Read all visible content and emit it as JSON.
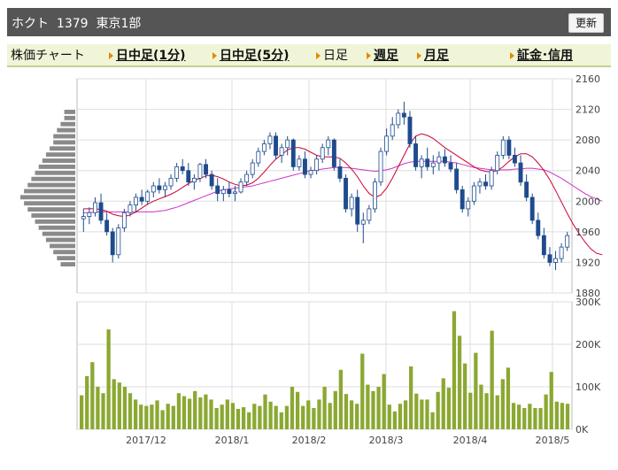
{
  "header": {
    "stock_name": "ホクト",
    "code": "1379",
    "market": "東京1部",
    "refresh_label": "更新"
  },
  "tabs": {
    "label": "株価チャート",
    "intraday_1": "日中足(1分)",
    "intraday_5": "日中足(5分)",
    "daily": "日足",
    "weekly": "週足",
    "monthly": "月足",
    "margin": "証金･信用"
  },
  "colors": {
    "up": "#ffffff",
    "down": "#1e4b8c",
    "candle_edge": "#1e4b8c",
    "ma_short": "#cc0033",
    "ma_long": "#cc33cc",
    "volume": "#8ba832",
    "profile": "#8a8a8a"
  },
  "chart_data": [
    {
      "type": "candlestick",
      "price_ylim": [
        1880,
        2160
      ],
      "price_ticks": [
        "2160",
        "2120",
        "2080",
        "2040",
        "2000",
        "1960",
        "1920",
        "1880"
      ],
      "x_labels": [
        "2017/12",
        "2018/1",
        "2018/2",
        "2018/3",
        "2018/4",
        "2018/5"
      ],
      "candles": [
        [
          1977,
          1990,
          1960,
          1980
        ],
        [
          1980,
          1992,
          1970,
          1985
        ],
        [
          1985,
          2005,
          1980,
          1998
        ],
        [
          1998,
          2010,
          1970,
          1975
        ],
        [
          1975,
          1985,
          1955,
          1960
        ],
        [
          1960,
          1965,
          1920,
          1930
        ],
        [
          1930,
          1970,
          1925,
          1965
        ],
        [
          1965,
          1990,
          1960,
          1985
        ],
        [
          1985,
          2000,
          1980,
          1995
        ],
        [
          1995,
          2010,
          1985,
          2005
        ],
        [
          2005,
          2015,
          1995,
          2000
        ],
        [
          2000,
          2015,
          1995,
          2012
        ],
        [
          2012,
          2025,
          2005,
          2020
        ],
        [
          2020,
          2030,
          2010,
          2015
        ],
        [
          2015,
          2025,
          2005,
          2020
        ],
        [
          2020,
          2035,
          2015,
          2030
        ],
        [
          2030,
          2050,
          2025,
          2045
        ],
        [
          2045,
          2055,
          2035,
          2040
        ],
        [
          2040,
          2050,
          2020,
          2025
        ],
        [
          2025,
          2035,
          2015,
          2030
        ],
        [
          2030,
          2050,
          2025,
          2048
        ],
        [
          2048,
          2055,
          2030,
          2035
        ],
        [
          2035,
          2040,
          2015,
          2020
        ],
        [
          2020,
          2030,
          2000,
          2010
        ],
        [
          2010,
          2020,
          2000,
          2015
        ],
        [
          2015,
          2025,
          2005,
          2010
        ],
        [
          2010,
          2020,
          2000,
          2012
        ],
        [
          2012,
          2030,
          2010,
          2025
        ],
        [
          2025,
          2040,
          2020,
          2035
        ],
        [
          2035,
          2055,
          2030,
          2050
        ],
        [
          2050,
          2070,
          2045,
          2065
        ],
        [
          2065,
          2080,
          2060,
          2075
        ],
        [
          2075,
          2090,
          2068,
          2085
        ],
        [
          2085,
          2090,
          2055,
          2060
        ],
        [
          2060,
          2075,
          2050,
          2070
        ],
        [
          2070,
          2085,
          2060,
          2080
        ],
        [
          2080,
          2082,
          2040,
          2045
        ],
        [
          2045,
          2060,
          2040,
          2055
        ],
        [
          2055,
          2065,
          2030,
          2035
        ],
        [
          2035,
          2045,
          2030,
          2040
        ],
        [
          2040,
          2060,
          2035,
          2055
        ],
        [
          2055,
          2075,
          2050,
          2070
        ],
        [
          2070,
          2085,
          2060,
          2080
        ],
        [
          2080,
          2082,
          2040,
          2045
        ],
        [
          2045,
          2055,
          2025,
          2030
        ],
        [
          2030,
          2035,
          1985,
          1990
        ],
        [
          1990,
          2010,
          1980,
          2005
        ],
        [
          2005,
          2015,
          1960,
          1970
        ],
        [
          1970,
          1985,
          1945,
          1975
        ],
        [
          1975,
          1995,
          1970,
          1990
        ],
        [
          1990,
          2030,
          1985,
          2025
        ],
        [
          2025,
          2070,
          2020,
          2065
        ],
        [
          2065,
          2095,
          2060,
          2085
        ],
        [
          2085,
          2110,
          2080,
          2100
        ],
        [
          2100,
          2120,
          2095,
          2115
        ],
        [
          2115,
          2130,
          2100,
          2110
        ],
        [
          2110,
          2118,
          2070,
          2075
        ],
        [
          2075,
          2085,
          2040,
          2045
        ],
        [
          2045,
          2060,
          2030,
          2055
        ],
        [
          2055,
          2070,
          2040,
          2045
        ],
        [
          2045,
          2060,
          2035,
          2050
        ],
        [
          2050,
          2065,
          2040,
          2058
        ],
        [
          2058,
          2068,
          2045,
          2050
        ],
        [
          2050,
          2060,
          2038,
          2042
        ],
        [
          2042,
          2050,
          2010,
          2015
        ],
        [
          2015,
          2020,
          1985,
          1990
        ],
        [
          1990,
          2005,
          1980,
          2000
        ],
        [
          2000,
          2025,
          1995,
          2020
        ],
        [
          2020,
          2030,
          2010,
          2025
        ],
        [
          2025,
          2035,
          2015,
          2020
        ],
        [
          2020,
          2045,
          2015,
          2040
        ],
        [
          2040,
          2065,
          2035,
          2060
        ],
        [
          2060,
          2085,
          2055,
          2080
        ],
        [
          2080,
          2085,
          2055,
          2060
        ],
        [
          2060,
          2070,
          2045,
          2050
        ],
        [
          2050,
          2060,
          2020,
          2025
        ],
        [
          2025,
          2035,
          2000,
          2005
        ],
        [
          2005,
          2010,
          1970,
          1975
        ],
        [
          1975,
          1985,
          1950,
          1955
        ],
        [
          1955,
          1965,
          1925,
          1930
        ],
        [
          1930,
          1940,
          1915,
          1920
        ],
        [
          1920,
          1935,
          1910,
          1925
        ],
        [
          1925,
          1945,
          1920,
          1940
        ],
        [
          1940,
          1960,
          1935,
          1955
        ]
      ],
      "ma_short": [
        1990,
        1990,
        1990,
        1989,
        1987,
        1983,
        1981,
        1980,
        1982,
        1986,
        1991,
        1996,
        2000,
        2003,
        2006,
        2009,
        2013,
        2018,
        2023,
        2027,
        2030,
        2033,
        2034,
        2032,
        2029,
        2025,
        2022,
        2020,
        2021,
        2024,
        2030,
        2038,
        2047,
        2055,
        2061,
        2067,
        2070,
        2070,
        2068,
        2064,
        2060,
        2058,
        2058,
        2058,
        2056,
        2050,
        2042,
        2032,
        2020,
        2010,
        2005,
        2008,
        2017,
        2030,
        2045,
        2060,
        2075,
        2085,
        2088,
        2086,
        2082,
        2076,
        2070,
        2065,
        2060,
        2055,
        2050,
        2045,
        2041,
        2039,
        2038,
        2040,
        2045,
        2052,
        2058,
        2062,
        2062,
        2058,
        2050,
        2040,
        2028,
        2014,
        1999,
        1984,
        1970,
        1958,
        1947,
        1938,
        1932,
        1930
      ],
      "ma_long": [
        1985,
        1985,
        1986,
        1986,
        1986,
        1986,
        1986,
        1986,
        1986,
        1986,
        1986,
        1986,
        1986,
        1987,
        1988,
        1990,
        1992,
        1995,
        1998,
        2001,
        2004,
        2007,
        2010,
        2013,
        2015,
        2016,
        2017,
        2018,
        2019,
        2020,
        2022,
        2024,
        2026,
        2028,
        2030,
        2032,
        2034,
        2036,
        2038,
        2040,
        2041,
        2042,
        2043,
        2044,
        2044,
        2044,
        2043,
        2042,
        2041,
        2040,
        2039,
        2040,
        2041,
        2043,
        2046,
        2049,
        2051,
        2052,
        2052,
        2052,
        2052,
        2052,
        2052,
        2051,
        2050,
        2048,
        2046,
        2044,
        2043,
        2042,
        2041,
        2041,
        2041,
        2041,
        2042,
        2042,
        2043,
        2043,
        2042,
        2041,
        2038,
        2034,
        2030,
        2025,
        2020,
        2015,
        2010,
        2006,
        2003,
        2000
      ],
      "volume_ylim": [
        0,
        300000
      ],
      "volume_ticks": [
        "300K",
        "200K",
        "100K",
        "0K"
      ],
      "volume": [
        80000,
        125000,
        158000,
        100000,
        85000,
        235000,
        118000,
        110000,
        100000,
        85000,
        70000,
        58000,
        55000,
        58000,
        68000,
        45000,
        60000,
        55000,
        85000,
        78000,
        72000,
        90000,
        75000,
        82000,
        70000,
        50000,
        58000,
        70000,
        62000,
        48000,
        52000,
        40000,
        60000,
        55000,
        82000,
        65000,
        55000,
        40000,
        55000,
        100000,
        88000,
        55000,
        68000,
        50000,
        70000,
        100000,
        62000,
        90000,
        140000,
        83000,
        68000,
        60000,
        178000,
        105000,
        90000,
        100000,
        130000,
        58000,
        42000,
        60000,
        68000,
        148000,
        84000,
        70000,
        70000,
        40000,
        88000,
        120000,
        98000,
        278000,
        220000,
        155000,
        86000,
        180000,
        105000,
        85000,
        232000,
        80000,
        118000,
        145000,
        62000,
        58000,
        50000,
        60000,
        50000,
        50000,
        82000,
        135000,
        65000,
        62000,
        60000
      ],
      "volume_profile": [
        3,
        3,
        4,
        5,
        6,
        6,
        7,
        8,
        9,
        10,
        11,
        12,
        13,
        14,
        15,
        14,
        13,
        12,
        11,
        10,
        9,
        8,
        7,
        6,
        5,
        4
      ]
    }
  ]
}
